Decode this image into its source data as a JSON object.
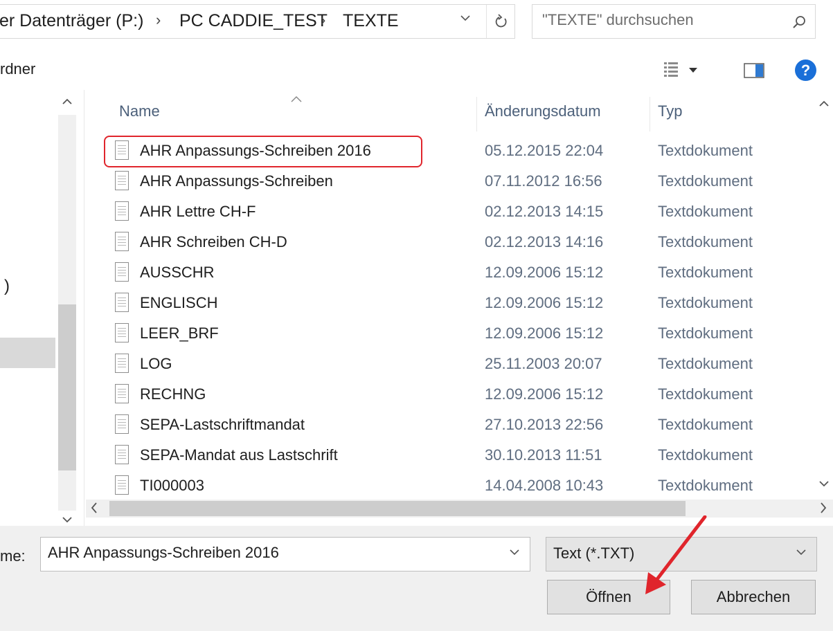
{
  "address_bar": {
    "breadcrumbs": [
      "er Datenträger (P:)",
      "PC CADDIE_TEST",
      "TEXTE"
    ],
    "search_placeholder": "\"TEXTE\" durchsuchen"
  },
  "toolbar": {
    "new_folder_label": "rdner"
  },
  "file_list": {
    "columns": [
      "Name",
      "Änderungsdatum",
      "Typ"
    ],
    "rows": [
      {
        "name": "AHR Anpassungs-Schreiben 2016",
        "date": "05.12.2015 22:04",
        "type": "Textdokument"
      },
      {
        "name": "AHR Anpassungs-Schreiben",
        "date": "07.11.2012 16:56",
        "type": "Textdokument"
      },
      {
        "name": "AHR Lettre CH-F",
        "date": "02.12.2013 14:15",
        "type": "Textdokument"
      },
      {
        "name": "AHR Schreiben CH-D",
        "date": "02.12.2013 14:16",
        "type": "Textdokument"
      },
      {
        "name": "AUSSCHR",
        "date": "12.09.2006 15:12",
        "type": "Textdokument"
      },
      {
        "name": "ENGLISCH",
        "date": "12.09.2006 15:12",
        "type": "Textdokument"
      },
      {
        "name": "LEER_BRF",
        "date": "12.09.2006 15:12",
        "type": "Textdokument"
      },
      {
        "name": "LOG",
        "date": "25.11.2003 20:07",
        "type": "Textdokument"
      },
      {
        "name": "RECHNG",
        "date": "12.09.2006 15:12",
        "type": "Textdokument"
      },
      {
        "name": "SEPA-Lastschriftmandat",
        "date": "27.10.2013 22:56",
        "type": "Textdokument"
      },
      {
        "name": "SEPA-Mandat aus Lastschrift",
        "date": "30.10.2013 11:51",
        "type": "Textdokument"
      },
      {
        "name": "TI000003",
        "date": "14.04.2008 10:43",
        "type": "Textdokument"
      }
    ]
  },
  "nav_pane": {
    "partial_text": ")"
  },
  "bottom": {
    "filename_label": "me:",
    "filename_value": "AHR Anpassungs-Schreiben 2016",
    "filetype_value": "Text (*.TXT)",
    "open_label": "Öffnen",
    "cancel_label": "Abbrechen"
  },
  "icons": {
    "breadcrumb_separator": "chevron-right-icon",
    "addr_dropdown": "chevron-down-icon",
    "refresh": "refresh-icon",
    "search": "search-icon",
    "view": "view-options-icon",
    "pane": "preview-pane-icon",
    "help": "help-icon",
    "file": "text-file-icon"
  },
  "colors": {
    "highlight": "#e0252c",
    "help_blue": "#1a6fd8",
    "annotation_arrow": "#e0252c"
  },
  "help_glyph": "?"
}
